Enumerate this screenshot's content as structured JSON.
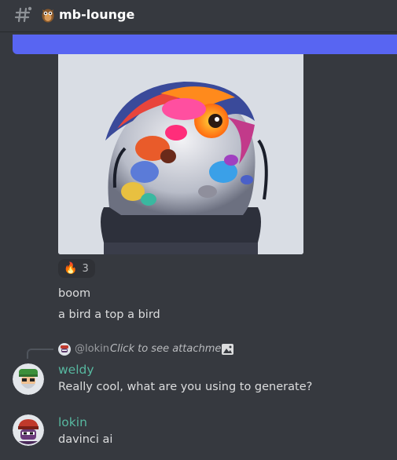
{
  "header": {
    "channel_name": "mb-lounge",
    "channel_emoji": "owl-emoji-icon"
  },
  "message_top": {
    "reaction": {
      "emoji": "🔥",
      "count": "3"
    },
    "lines": [
      "boom",
      "a bird a top a bird"
    ]
  },
  "reply": {
    "reply_to_user": "@lokin",
    "reply_preview": "Click to see attachment"
  },
  "messages": [
    {
      "username": "weldy",
      "text": "Really cool, what are you using to generate?"
    },
    {
      "username": "lokin",
      "text": "davinci ai"
    }
  ],
  "colors": {
    "background": "#36393f",
    "accent": "#5865f2",
    "username": "#57b8a0"
  }
}
